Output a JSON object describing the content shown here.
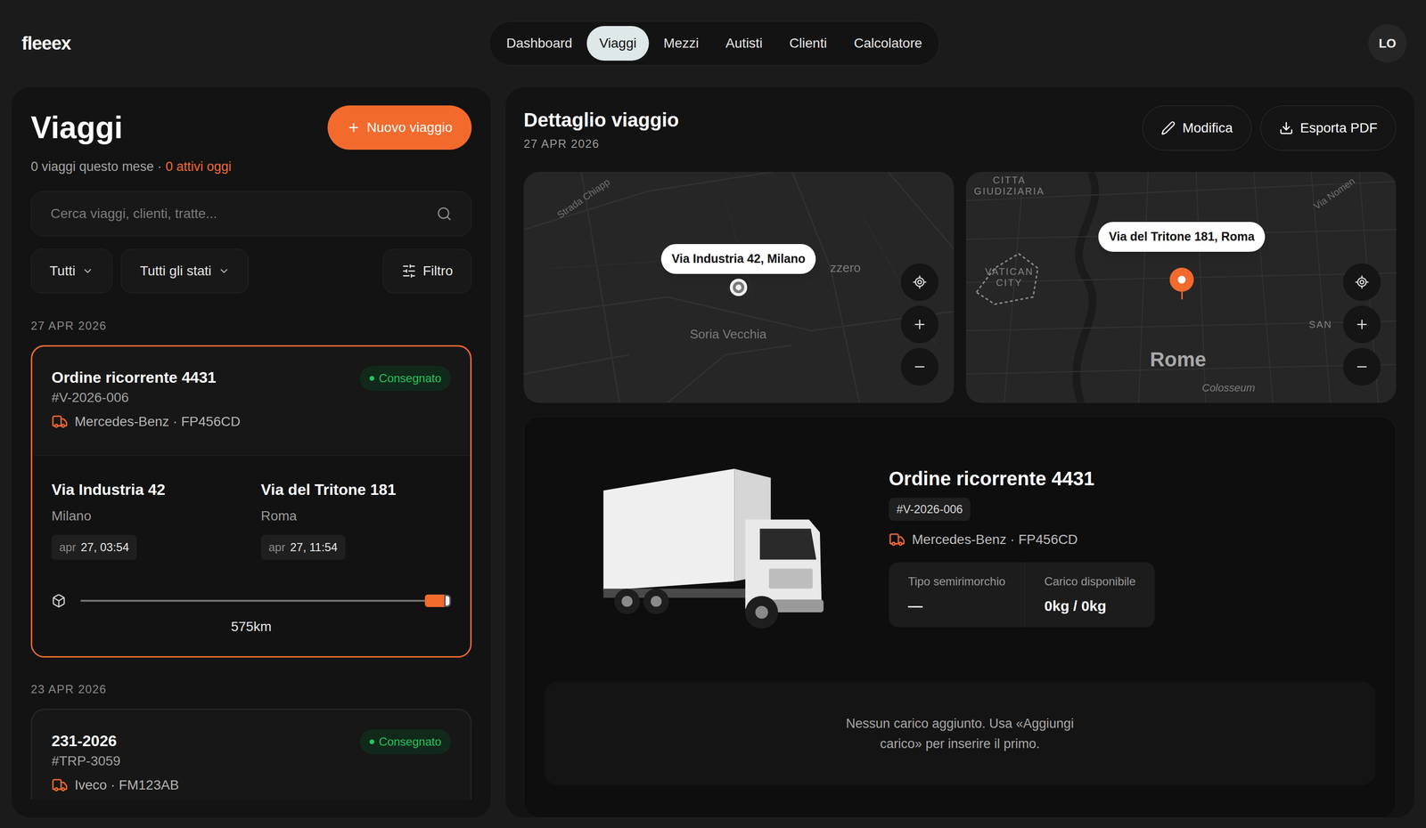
{
  "app": {
    "logo": "fleeex",
    "avatar": "LO"
  },
  "nav": [
    {
      "label": "Dashboard",
      "selected": false
    },
    {
      "label": "Viaggi",
      "selected": true
    },
    {
      "label": "Mezzi",
      "selected": false
    },
    {
      "label": "Autisti",
      "selected": false
    },
    {
      "label": "Clienti",
      "selected": false
    },
    {
      "label": "Calcolatore",
      "selected": false
    }
  ],
  "list": {
    "title": "Viaggi",
    "new_button": "Nuovo viaggio",
    "summary": "0 viaggi questo mese ·",
    "active_today": "0 attivi oggi",
    "search": {
      "placeholder": "Cerca viaggi, clienti, tratte..."
    },
    "filters": [
      "Tutti",
      "Tutti gli stati"
    ],
    "filter_button": "Filtro",
    "groups": [
      {
        "date": "27 APR 2026",
        "trips": [
          {
            "title": "Ordine ricorrente 4431",
            "code": "#V-2026-006",
            "vehicle": "Mercedes-Benz · FP456CD",
            "status": "Consegnato",
            "selected": true,
            "from": {
              "street": "Via Industria 42",
              "city": "Milano",
              "month": "apr",
              "time": "27, 03:54"
            },
            "to": {
              "street": "Via del Tritone 181",
              "city": "Roma",
              "month": "apr",
              "time": "27, 11:54"
            },
            "level": 1,
            "distance": "575km"
          }
        ]
      },
      {
        "date": "23 APR 2026",
        "trips": [
          {
            "title": "231-2026",
            "code": "#TRP-3059",
            "vehicle": "Iveco · FM123AB",
            "status": "Consegnato",
            "selected": false
          }
        ]
      }
    ]
  },
  "detail": {
    "title": "Dettaglio viaggio",
    "date": "27 APR 2026",
    "buttons": [
      "Modifica",
      "Esporta PDF"
    ],
    "maps": [
      {
        "label": "Via Industria 42, Milano",
        "kind": "origin",
        "places": [
          {
            "text": "Strada Chiapp",
            "kind": "road"
          },
          {
            "text": "zzero",
            "kind": "area"
          },
          {
            "text": "Soria Vecchia",
            "kind": "area"
          }
        ]
      },
      {
        "label": "Via del Tritone 181, Roma",
        "kind": "destination",
        "places": [
          {
            "text": "CITTA GIUDIZIARIA",
            "kind": "district"
          },
          {
            "text": "VATICAN CITY",
            "kind": "district"
          },
          {
            "text": "Rome",
            "kind": "city"
          },
          {
            "text": "Colosseum",
            "kind": "poi"
          },
          {
            "text": "Via Nomen",
            "kind": "road"
          },
          {
            "text": "SAN",
            "kind": "district"
          }
        ]
      }
    ],
    "trip": {
      "title": "Ordine ricorrente 4431",
      "code": "#V-2026-006",
      "vehicle": "Mercedes-Benz · FP456CD",
      "specs": [
        {
          "label": "Tipo semirimorchio",
          "value": "—"
        },
        {
          "label": "Carico disponibile",
          "value": "0kg / 0kg"
        }
      ]
    },
    "empty_load": "Nessun carico aggiunto. Usa «Aggiungi carico» per inserire il primo."
  }
}
